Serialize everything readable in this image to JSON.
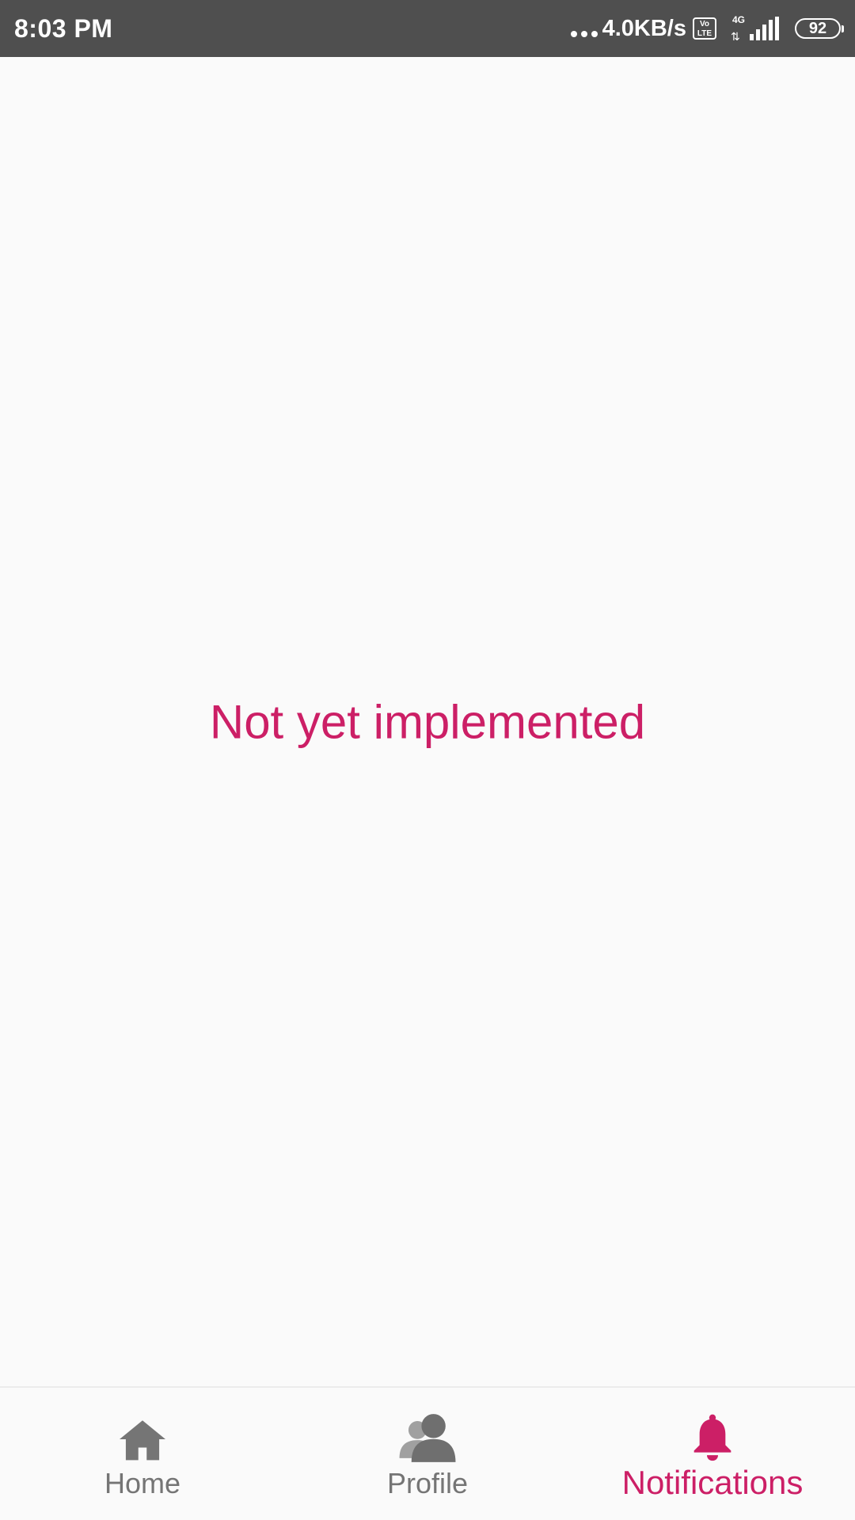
{
  "status_bar": {
    "time": "8:03 PM",
    "net_speed": "4.0KB/s",
    "volte_label": "Vo LTE",
    "network_type": "4G",
    "battery_level": "92",
    "icons": [
      "dots-icon",
      "volte-icon",
      "network-type-icon",
      "signal-icon",
      "battery-icon"
    ]
  },
  "main": {
    "message": "Not yet implemented"
  },
  "bottom_nav": {
    "active_index": 2,
    "items": [
      {
        "label": "Home",
        "icon": "home-icon"
      },
      {
        "label": "Profile",
        "icon": "profile-icon"
      },
      {
        "label": "Notifications",
        "icon": "bell-icon"
      }
    ]
  },
  "colors": {
    "accent": "#cc1f66",
    "inactive": "#757575",
    "status_bar": "#4f4f4f",
    "background": "#fafafa"
  }
}
